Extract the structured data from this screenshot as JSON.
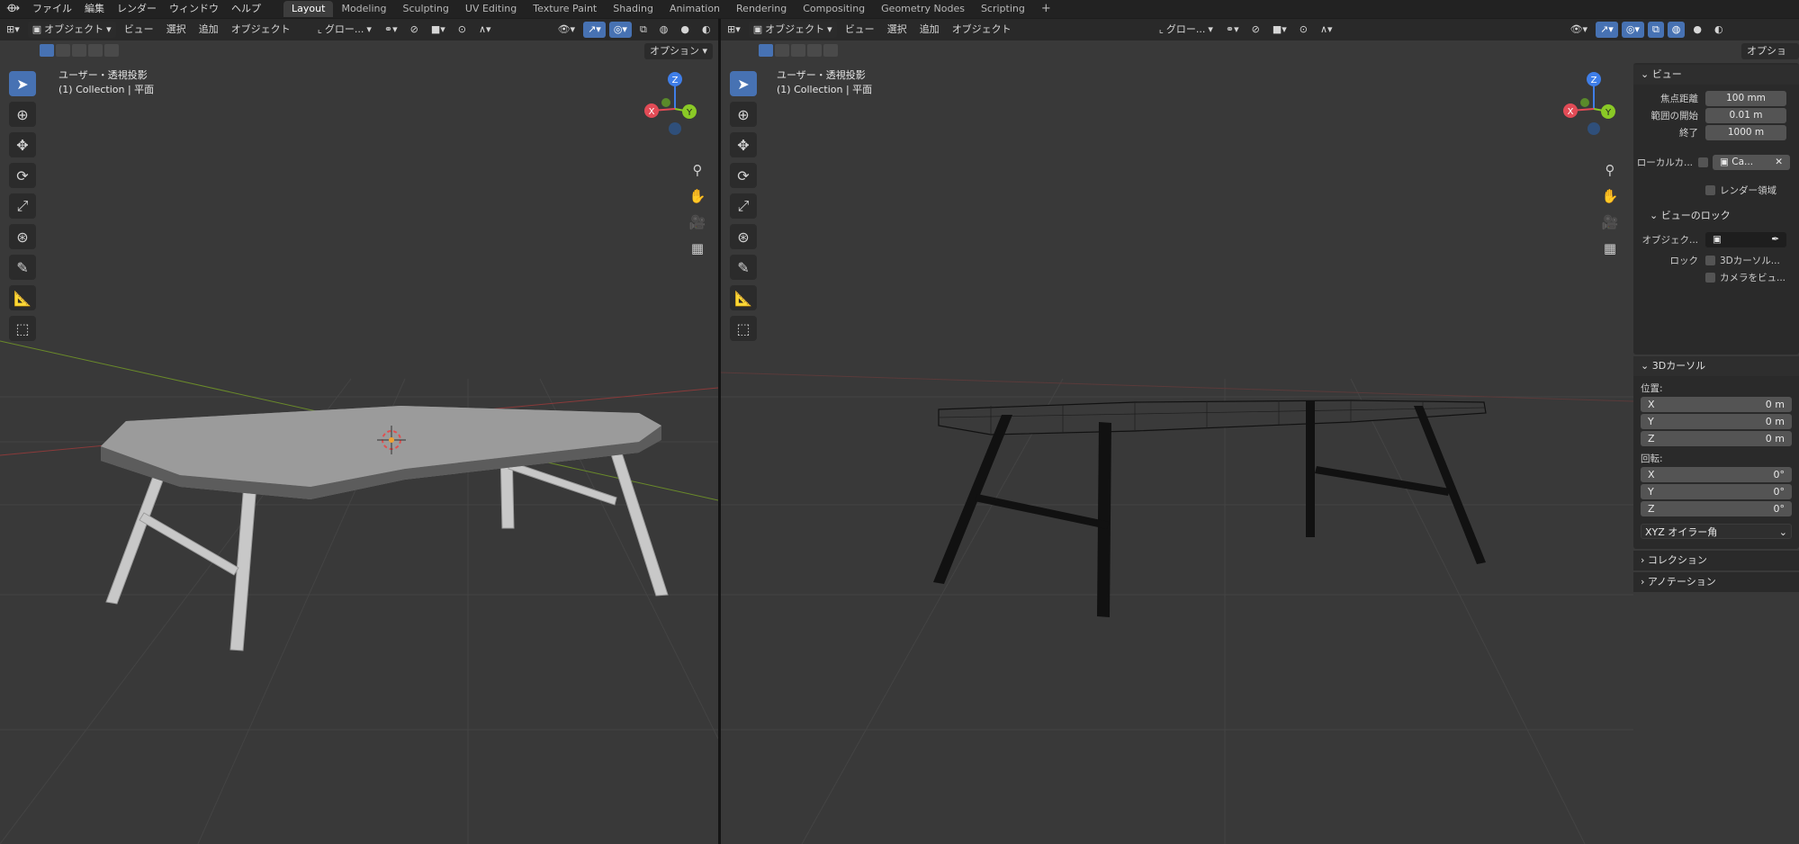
{
  "top_menu": [
    "ファイル",
    "編集",
    "レンダー",
    "ウィンドウ",
    "ヘルプ"
  ],
  "workspace_tabs": [
    {
      "label": "Layout",
      "active": true
    },
    {
      "label": "Modeling",
      "active": false
    },
    {
      "label": "Sculpting",
      "active": false
    },
    {
      "label": "UV Editing",
      "active": false
    },
    {
      "label": "Texture Paint",
      "active": false
    },
    {
      "label": "Shading",
      "active": false
    },
    {
      "label": "Animation",
      "active": false
    },
    {
      "label": "Rendering",
      "active": false
    },
    {
      "label": "Compositing",
      "active": false
    },
    {
      "label": "Geometry Nodes",
      "active": false
    },
    {
      "label": "Scripting",
      "active": false
    }
  ],
  "add_tab": "+",
  "header": {
    "mode": "オブジェクト",
    "menu": [
      "ビュー",
      "選択",
      "追加",
      "オブジェクト"
    ],
    "orientation": "グロー..."
  },
  "options_label": "オプション",
  "viewport_info": {
    "line1": "ユーザー・透視投影",
    "line2": "(1) Collection | 平面"
  },
  "gizmo": {
    "z": "Z",
    "y": "Y",
    "x": "X"
  },
  "n_panel": {
    "view": {
      "title": "ビュー",
      "focal_label": "焦点距離",
      "focal_value": "100 mm",
      "clip_start_label": "範囲の開始",
      "clip_start_value": "0.01 m",
      "clip_end_label": "終了",
      "clip_end_value": "1000 m",
      "local_camera_label": "ローカルカ...",
      "local_camera_value": "Ca...",
      "render_region": "レンダー領域"
    },
    "view_lock": {
      "title": "ビューのロック",
      "object_label": "オブジェク...",
      "lock_label": "ロック",
      "lock_3d_cursor": "3Dカーソル...",
      "lock_camera": "カメラをビュ..."
    },
    "cursor": {
      "title": "3Dカーソル",
      "location_label": "位置:",
      "x_label": "X",
      "x": "0 m",
      "y_label": "Y",
      "y": "0 m",
      "z_label": "Z",
      "z": "0 m",
      "rotation_label": "回転:",
      "rx_label": "X",
      "rx": "0°",
      "ry_label": "Y",
      "ry": "0°",
      "rz_label": "Z",
      "rz": "0°",
      "rotation_mode": "XYZ オイラー角"
    },
    "collection": "コレクション",
    "annotation": "アノテーション"
  },
  "colors": {
    "accent": "#4772b3",
    "axis_x": "#e24b56",
    "axis_y": "#8ac926",
    "axis_z": "#3f7ee8"
  }
}
